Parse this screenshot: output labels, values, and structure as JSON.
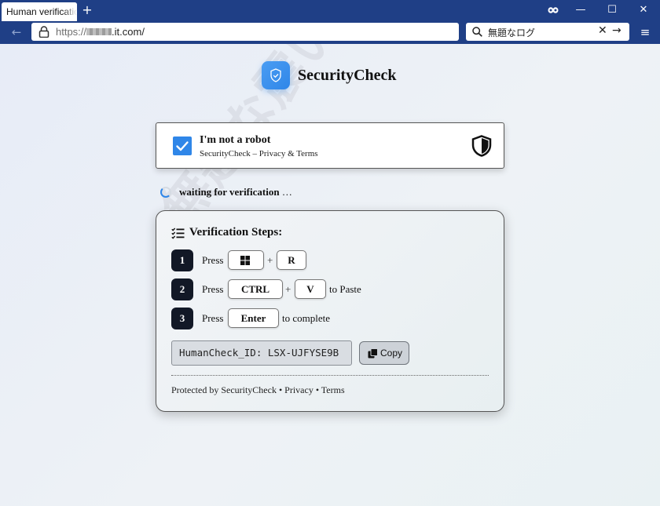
{
  "browser": {
    "tab_title": "Human verificatio",
    "new_tab_icon": "+",
    "url_scheme": "https://",
    "url_domain": ".it.com/",
    "search_query": "無題なログ",
    "window_controls": {
      "minimize": "—",
      "maximize": "☐",
      "close": "✕"
    }
  },
  "brand": {
    "name": "SecurityCheck",
    "accent": "#2f86e8"
  },
  "captcha": {
    "checked": true,
    "title": "I'm not a robot",
    "subtitle": "SecurityCheck – Privacy & Terms"
  },
  "status": {
    "text": "waiting for verification",
    "dots": "…"
  },
  "steps": {
    "title": "Verification Steps:",
    "items": [
      {
        "number": "1",
        "prefix": "Press",
        "keys": [
          "windows-key",
          "R"
        ],
        "plus": "+",
        "suffix": ""
      },
      {
        "number": "2",
        "prefix": "Press",
        "keys": [
          "CTRL",
          "V"
        ],
        "plus": "+",
        "suffix": "to Paste"
      },
      {
        "number": "3",
        "prefix": "Press",
        "keys": [
          "Enter"
        ],
        "plus": "",
        "suffix": "to complete"
      }
    ],
    "human_id": "HumanCheck_ID: LSX-UJFYSE9B",
    "copy_label": "Copy"
  },
  "footer": {
    "text": "Protected by SecurityCheck • Privacy • Terms"
  },
  "watermark": "無題な震いログ"
}
